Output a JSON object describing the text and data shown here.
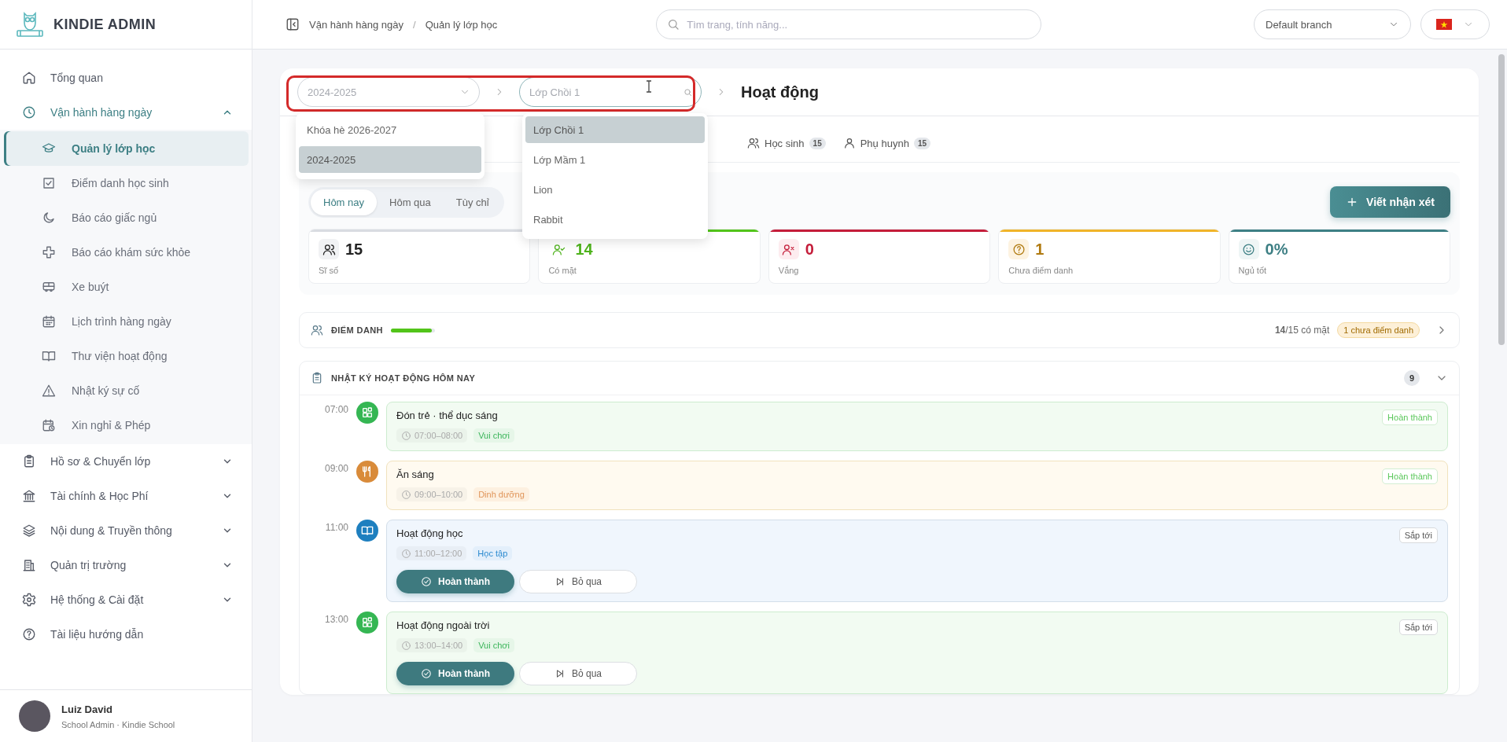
{
  "sidebar": {
    "brand": "KINDIE ADMIN",
    "items": [
      {
        "kind": "link",
        "label": "Tổng quan",
        "selected": false
      },
      {
        "kind": "group",
        "label": "Vận hành hàng ngày",
        "selected": false,
        "expanded": true,
        "children": [
          {
            "label": "Quản lý lớp học",
            "selected": true
          },
          {
            "label": "Điểm danh học sinh",
            "selected": false
          },
          {
            "label": "Báo cáo giấc ngủ",
            "selected": false
          },
          {
            "label": "Báo cáo khám sức khỏe",
            "selected": false
          },
          {
            "label": "Xe buýt",
            "selected": false
          },
          {
            "label": "Lịch trình hàng ngày",
            "selected": false
          },
          {
            "label": "Thư viện hoạt động",
            "selected": false
          },
          {
            "label": "Nhật ký sự cố",
            "selected": false
          },
          {
            "label": "Xin nghỉ & Phép",
            "selected": false
          }
        ]
      },
      {
        "kind": "group",
        "label": "Hồ sơ & Chuyển lớp",
        "selected": false,
        "expanded": false
      },
      {
        "kind": "group",
        "label": "Tài chính & Học Phí",
        "selected": false,
        "expanded": false
      },
      {
        "kind": "group",
        "label": "Nội dung & Truyền thông",
        "selected": false,
        "expanded": false
      },
      {
        "kind": "group",
        "label": "Quản trị trường",
        "selected": false,
        "expanded": false
      },
      {
        "kind": "group",
        "label": "Hệ thống & Cài đặt",
        "selected": false,
        "expanded": false
      },
      {
        "kind": "link",
        "label": "Tài liệu hướng dẫn",
        "selected": false
      }
    ],
    "user": {
      "name": "Luiz David",
      "role": "School Admin · Kindie School"
    }
  },
  "topbar": {
    "breadcrumb": [
      "Vận hành hàng ngày",
      "Quản lý lớp học"
    ],
    "breadcrumb_separator": "/",
    "search": {
      "placeholder": "Tìm trang, tính năng..."
    },
    "branch": {
      "value": "Default branch"
    }
  },
  "selector": {
    "year": {
      "placeholder": "2024-2025"
    },
    "class": {
      "placeholder": "Lớp Chồi 1"
    },
    "title": "Hoạt động"
  },
  "year_menu": [
    {
      "label": "Khóa hè 2026-2027",
      "selected": false
    },
    {
      "label": "2024-2025",
      "selected": true
    }
  ],
  "class_menu": [
    {
      "label": "Lớp Chồi 1",
      "selected": true
    },
    {
      "label": "Lớp Mầm 1",
      "selected": false
    },
    {
      "label": "Lion",
      "selected": false
    },
    {
      "label": "Rabbit",
      "selected": false
    }
  ],
  "tabs": [
    {
      "kind": "students",
      "label": "Học sinh",
      "count": "15",
      "selected": false
    },
    {
      "kind": "parents",
      "label": "Phụ huynh",
      "count": "15",
      "selected": false
    }
  ],
  "range": [
    {
      "label": "Hôm nay",
      "selected": true
    },
    {
      "label": "Hôm qua",
      "selected": false
    },
    {
      "label": "Tùy chỉ",
      "selected": false
    }
  ],
  "write_button": "Viết nhận xét",
  "stats": [
    {
      "kind": "total",
      "value": "15",
      "label": "Sĩ số",
      "color": "#d9dce1"
    },
    {
      "kind": "present",
      "value": "14",
      "label": "Có mặt",
      "color": "#52c41a"
    },
    {
      "kind": "absent",
      "value": "0",
      "label": "Vắng",
      "color": "#c41d3a"
    },
    {
      "kind": "unmarked",
      "value": "1",
      "label": "Chưa điểm danh",
      "color": "#f0b429"
    },
    {
      "kind": "sleep",
      "value": "0%",
      "label": "Ngủ tốt",
      "color": "#3d7f84"
    }
  ],
  "attendance": {
    "title": "ĐIỂM DANH",
    "level": 0.93,
    "summary": "**14**/15 có mặt",
    "badge": "1 chưa điểm danh"
  },
  "log": {
    "title": "NHẬT KÝ HOẠT ĐỘNG HÔM NAY",
    "count": "9",
    "expanded": true,
    "items": [
      {
        "kind": "play",
        "time": "07:00",
        "title": "Đón trẻ · thể dục sáng",
        "range": "07:00–08:00",
        "tag": "Vui chơi",
        "status": {
          "kind": "done",
          "label": "Hoàn thành"
        }
      },
      {
        "kind": "meal",
        "time": "09:00",
        "title": "Ăn sáng",
        "range": "09:00–10:00",
        "tag": "Dinh dưỡng",
        "status": {
          "kind": "done",
          "label": "Hoàn thành"
        }
      },
      {
        "kind": "study",
        "time": "11:00",
        "title": "Hoạt động học",
        "range": "11:00–12:00",
        "tag": "Học tập",
        "status": {
          "kind": "upcoming",
          "label": "Sắp tới"
        },
        "actions": [
          {
            "kind": "complete",
            "label": "Hoàn thành"
          },
          {
            "kind": "skip",
            "label": "Bỏ qua"
          }
        ]
      },
      {
        "kind": "play",
        "time": "13:00",
        "title": "Hoạt động ngoài trời",
        "range": "13:00–14:00",
        "tag": "Vui chơi",
        "status": {
          "kind": "upcoming",
          "label": "Sắp tới"
        },
        "actions": [
          {
            "kind": "complete",
            "label": "Hoàn thành"
          },
          {
            "kind": "skip",
            "label": "Bỏ qua"
          }
        ]
      }
    ]
  }
}
